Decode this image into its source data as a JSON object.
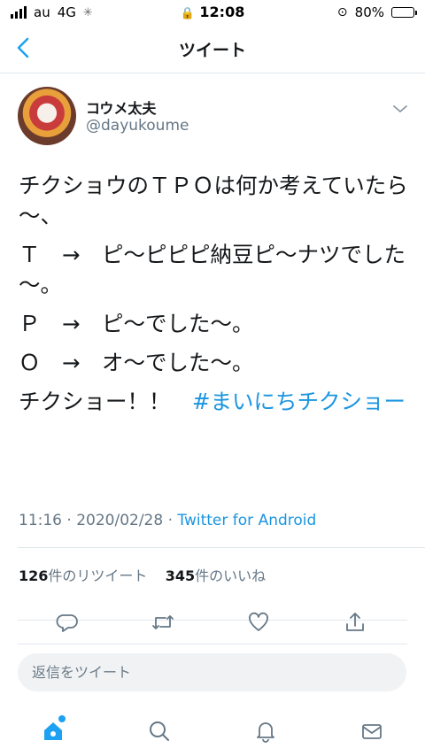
{
  "status_bar": {
    "carrier": "au",
    "network": "4G",
    "time": "12:08",
    "battery": "80%",
    "battery_level": 0.8
  },
  "nav": {
    "title": "ツイート"
  },
  "author": {
    "name": "コウメ太夫",
    "handle": "@dayukoume"
  },
  "tweet": {
    "lines": [
      "チクショウのＴＰＯは何か考えていたら～、",
      "Ｔ　→　ピ～ピピピ納豆ピ～ナツでした～。",
      "Ｐ　→　ピ～でした～。",
      "Ｏ　→　オ～でした～。"
    ],
    "last_text": "チクショー！！　",
    "hashtag": "#まいにちチクショー"
  },
  "meta": {
    "time": "11:16 · 2020/02/28 · ",
    "source": "Twitter for Android"
  },
  "stats": {
    "retweets": "126",
    "retweets_label": "件のリツイート",
    "likes": "345",
    "likes_label": "件のいいね"
  },
  "reply": {
    "placeholder": "返信をツイート"
  },
  "colors": {
    "accent": "#1da1f2",
    "link": "#1b95e0",
    "muted": "#657786"
  },
  "icons": [
    "back-icon",
    "caret-down-icon",
    "reply-icon",
    "retweet-icon",
    "like-icon",
    "share-icon",
    "home-icon",
    "search-icon",
    "notifications-icon",
    "messages-icon"
  ]
}
